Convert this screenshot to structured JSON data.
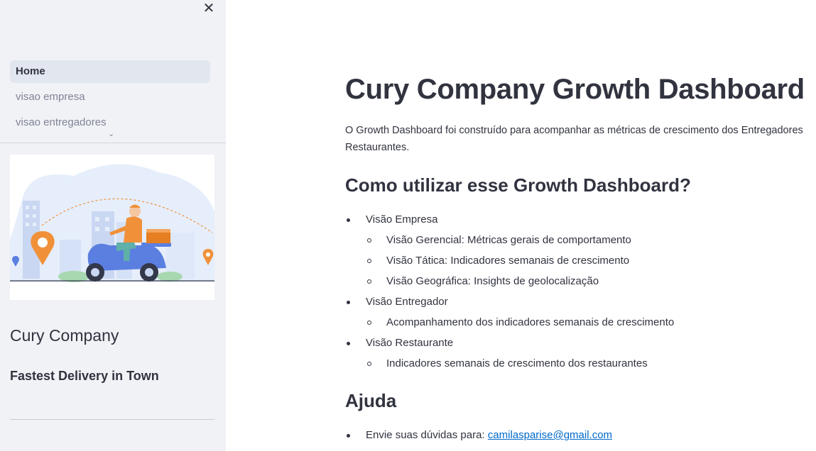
{
  "sidebar": {
    "close_icon": "close-icon",
    "nav": [
      {
        "label": "Home",
        "active": true
      },
      {
        "label": "visao empresa",
        "active": false
      },
      {
        "label": "visao entregadores",
        "active": false
      }
    ],
    "expand_icon": "chevron-down-icon",
    "company_name": "Cury Company",
    "tagline": "Fastest Delivery in Town"
  },
  "main": {
    "title": "Cury Company Growth Dashboard",
    "intro": "O Growth Dashboard foi construído para acompanhar as métricas de crescimento dos Entregadores\nRestaurantes.",
    "how_heading": "Como utilizar esse Growth Dashboard?",
    "features": [
      {
        "label": "Visão Empresa",
        "children": [
          "Visão Gerencial: Métricas gerais de comportamento",
          "Visão Tática: Indicadores semanais de crescimento",
          "Visão Geográfica: Insights de geolocalização"
        ]
      },
      {
        "label": "Visão Entregador",
        "children": [
          "Acompanhamento dos indicadores semanais de crescimento"
        ]
      },
      {
        "label": "Visão Restaurante",
        "children": [
          "Indicadores semanais de crescimento dos restaurantes"
        ]
      }
    ],
    "help_heading": "Ajuda",
    "help_prefix": "Envie suas dúvidas para: ",
    "help_email": "camilasparise@gmail.com"
  },
  "colors": {
    "sidebar_bg": "#f0f2f6",
    "text": "#31333f",
    "muted": "#808495",
    "link": "#0068c9",
    "accent_orange": "#f0913a",
    "accent_blue": "#5b7fe0"
  }
}
